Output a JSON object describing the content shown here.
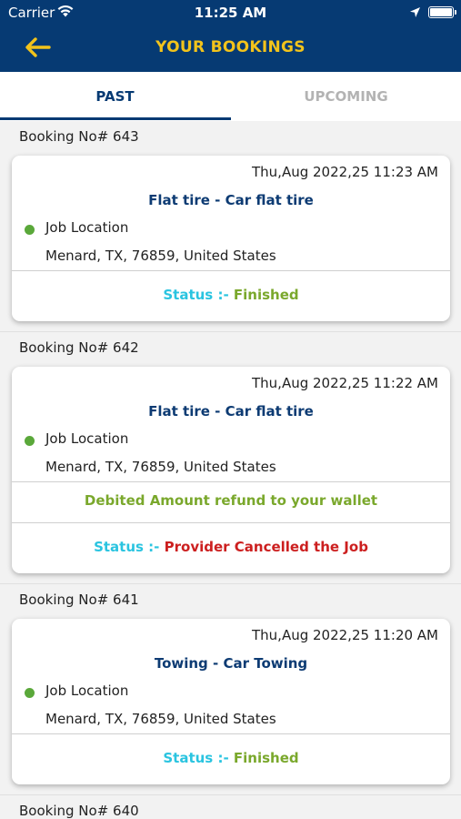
{
  "status_bar": {
    "carrier": "Carrier",
    "time": "11:25 AM",
    "icons": [
      "wifi-icon",
      "location-arrow-icon",
      "battery-icon"
    ]
  },
  "header": {
    "title": "YOUR BOOKINGS",
    "back_icon": "arrow-left-icon",
    "background_color": "#063a73",
    "title_color": "#f2c31b"
  },
  "tabs": [
    {
      "label": "PAST",
      "selected": true
    },
    {
      "label": "UPCOMING",
      "selected": false
    }
  ],
  "colors": {
    "status_label": "#2ac4e0",
    "finished": "#7aa82c",
    "cancelled": "#cc1f1f",
    "refund": "#7aa82c",
    "location_dot": "#5aa83a",
    "service": "#0d3b73"
  },
  "bookings": [
    {
      "number": "Booking No# 643",
      "date": "Thu,Aug 2022,25 11:23 AM",
      "service": "Flat tire - Car flat tire",
      "location_label": "Job Location",
      "address": "Menard, TX, 76859, United States",
      "status_label": "Status :-",
      "status_value": "Finished"
    },
    {
      "number": "Booking No# 642",
      "date": "Thu,Aug 2022,25 11:22 AM",
      "service": "Flat tire - Car flat tire",
      "location_label": "Job Location",
      "address": "Menard, TX, 76859, United States",
      "refund_note": "Debited Amount refund to your wallet",
      "status_label": "Status :-",
      "status_value": "Provider Cancelled the Job"
    },
    {
      "number": "Booking No# 641",
      "date": "Thu,Aug 2022,25 11:20 AM",
      "service": "Towing - Car Towing",
      "location_label": "Job Location",
      "address": "Menard, TX, 76859, United States",
      "status_label": "Status :-",
      "status_value": "Finished"
    },
    {
      "number": "Booking No# 640"
    }
  ]
}
